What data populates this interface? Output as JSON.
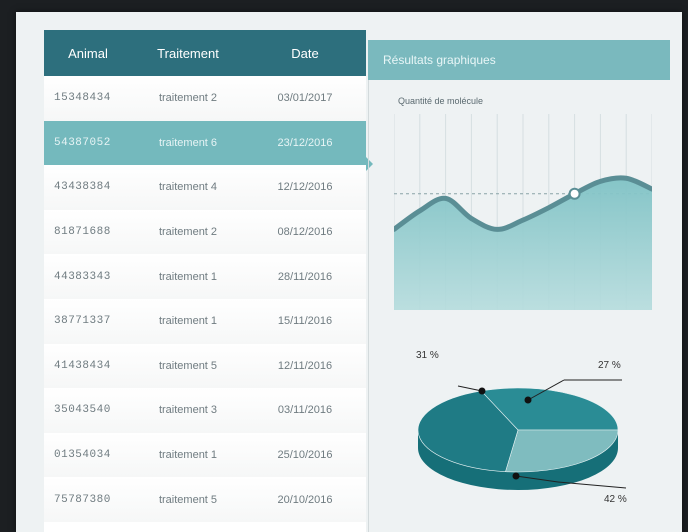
{
  "table": {
    "headers": {
      "animal": "Animal",
      "traitement": "Traitement",
      "date": "Date"
    },
    "rows": [
      {
        "animal": "15348434",
        "traitement": "traitement 2",
        "date": "03/01/2017"
      },
      {
        "animal": "54387052",
        "traitement": "traitement 6",
        "date": "23/12/2016"
      },
      {
        "animal": "43438384",
        "traitement": "traitement 4",
        "date": "12/12/2016"
      },
      {
        "animal": "81871688",
        "traitement": "traitement 2",
        "date": "08/12/2016"
      },
      {
        "animal": "44383343",
        "traitement": "traitement 1",
        "date": "28/11/2016"
      },
      {
        "animal": "38771337",
        "traitement": "traitement 1",
        "date": "15/11/2016"
      },
      {
        "animal": "41438434",
        "traitement": "traitement 5",
        "date": "12/11/2016"
      },
      {
        "animal": "35043540",
        "traitement": "traitement 3",
        "date": "03/11/2016"
      },
      {
        "animal": "01354034",
        "traitement": "traitement 1",
        "date": "25/10/2016"
      },
      {
        "animal": "75787380",
        "traitement": "traitement 5",
        "date": "20/10/2016"
      }
    ],
    "selected_index": 1
  },
  "graph": {
    "header": "Résultats graphiques",
    "line_title": "Quantité de molécule",
    "pie_labels": [
      "31 %",
      "27 %",
      "42 %"
    ]
  },
  "chart_data": [
    {
      "type": "area",
      "title": "Quantité de molécule",
      "xlabel": "",
      "ylabel": "",
      "grid": true,
      "series": [
        {
          "x": [
            0,
            1,
            2,
            3,
            4,
            5,
            6,
            7,
            8,
            9,
            10
          ],
          "values": [
            5.2,
            6.4,
            7.2,
            5.9,
            5.2,
            5.8,
            6.6,
            7.5,
            8.3,
            8.5,
            7.8
          ]
        }
      ],
      "highlight_index": 7,
      "ylim": [
        0,
        12
      ]
    },
    {
      "type": "pie",
      "labels": [
        "31 %",
        "27 %",
        "42 %"
      ],
      "values": [
        31,
        27,
        42
      ],
      "colors": [
        "#2a8c95",
        "#7fbcbf",
        "#1f7b85"
      ]
    }
  ],
  "colors": {
    "header_bg": "#2d6f7d",
    "selected_row": "#74b9bd",
    "graph_header": "#7ab9be",
    "accent": "#2a8c95"
  }
}
